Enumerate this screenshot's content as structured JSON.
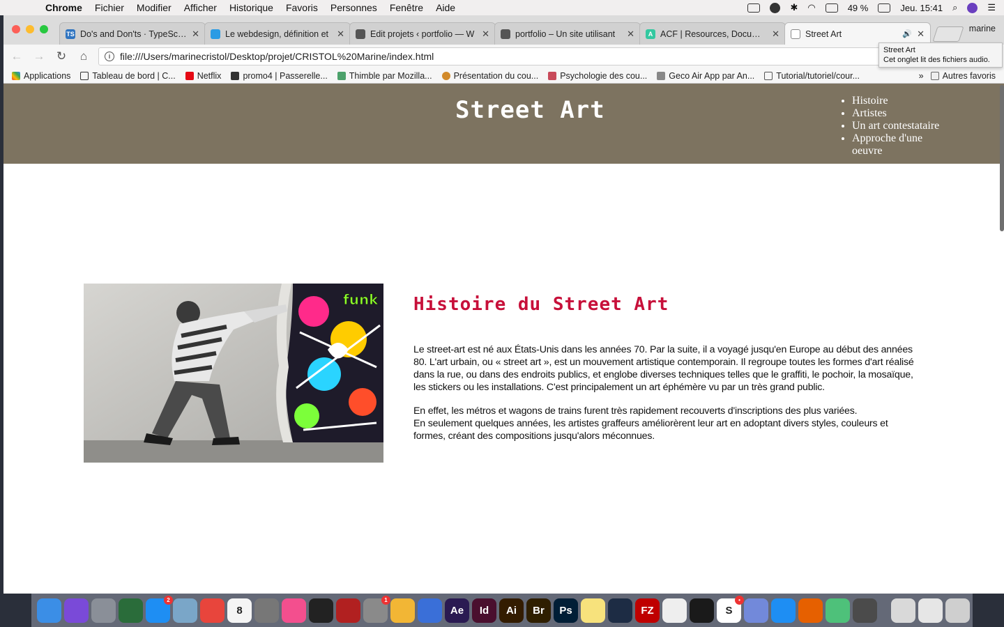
{
  "menubar": {
    "app_name": "Chrome",
    "menus": [
      "Fichier",
      "Modifier",
      "Afficher",
      "Historique",
      "Favoris",
      "Personnes",
      "Fenêtre",
      "Aide"
    ],
    "battery": "49 %",
    "clock": "Jeu. 15:41"
  },
  "tabs": [
    {
      "title": "Do's and Don'ts · TypeScript",
      "favicon": "TS",
      "color": "#2f74c0"
    },
    {
      "title": "Le webdesign, définition et",
      "favicon": "",
      "color": "#2b9be4"
    },
    {
      "title": "Edit projets ‹ portfolio — W",
      "favicon": "",
      "color": "#555555"
    },
    {
      "title": "portfolio – Un site utilisant",
      "favicon": "",
      "color": "#555555"
    },
    {
      "title": "ACF | Resources, Documen",
      "favicon": "A",
      "color": "#33c8a0"
    },
    {
      "title": "Street Art",
      "favicon": "",
      "color": "#ffffff"
    }
  ],
  "profile_name": "marine",
  "address_url": "file:///Users/marinecristol/Desktop/projet/CRISTOL%20Marine/index.html",
  "tooltip": {
    "title": "Street Art",
    "text": "Cet onglet lit des fichiers audio."
  },
  "bookmarks": [
    "Applications",
    "Tableau de bord | C...",
    "Netflix",
    "promo4 | Passerelle...",
    "Thimble par Mozilla...",
    "Présentation du cou...",
    "Psychologie des cou...",
    "Geco Air App par An...",
    "Tutorial/tutoriel/cour..."
  ],
  "bookmarks_other": "Autres favoris",
  "site": {
    "title": "Street Art",
    "nav": [
      "Histoire",
      "Artistes",
      "Un art contestataire",
      "Approche d'une oeuvre"
    ],
    "article_title": "Histoire du Street Art",
    "paragraphs": [
      "Le street-art est né aux États-Unis dans les années 70. Par la suite, il a voyagé jusqu'en Europe au début des années 80. L'art urbain, ou « street art », est un mouvement artistique contemporain. Il regroupe toutes les formes d'art réalisé dans la rue, ou dans des endroits publics, et englobe diverses techniques telles que le graffiti, le pochoir, la mosaïque, les stickers ou les installations. C'est principalement un art éphémère vu par un très grand public.",
      "En effet, les métros et wagons de trains furent très rapidement recouverts d'inscriptions des plus variées.",
      "En seulement quelques années, les artistes graffeurs améliorèrent leur art en adoptant divers styles, couleurs et formes, créant des compositions jusqu'alors méconnues."
    ],
    "image_tag": "funk"
  },
  "dock": [
    {
      "name": "finder-icon",
      "color": "#3b8ee6",
      "label": ""
    },
    {
      "name": "siri-icon",
      "color": "#7a4ad8",
      "label": ""
    },
    {
      "name": "launchpad-icon",
      "color": "#8a8f98",
      "label": ""
    },
    {
      "name": "mission-control-icon",
      "color": "#2a6c3a",
      "label": ""
    },
    {
      "name": "app-store-icon",
      "color": "#1e8ef3",
      "label": "",
      "badge": "2"
    },
    {
      "name": "preview-icon",
      "color": "#7aa6c8",
      "label": ""
    },
    {
      "name": "chrome-icon",
      "color": "#e8453c",
      "label": ""
    },
    {
      "name": "calendar-icon",
      "color": "#f5f5f5",
      "label": "8"
    },
    {
      "name": "sequel-icon",
      "color": "#777777",
      "label": ""
    },
    {
      "name": "itunes-icon",
      "color": "#f34f8e",
      "label": ""
    },
    {
      "name": "activity-monitor-icon",
      "color": "#222222",
      "label": ""
    },
    {
      "name": "photo-booth-icon",
      "color": "#b12020",
      "label": ""
    },
    {
      "name": "system-preferences-icon",
      "color": "#8a8a8a",
      "label": "",
      "badge": "1"
    },
    {
      "name": "photos-icon",
      "color": "#f2b635",
      "label": ""
    },
    {
      "name": "keynote-icon",
      "color": "#3a6fd8",
      "label": ""
    },
    {
      "name": "after-effects-icon",
      "color": "#2a1a52",
      "label": "Ae"
    },
    {
      "name": "indesign-icon",
      "color": "#4a0f2e",
      "label": "Id"
    },
    {
      "name": "illustrator-icon",
      "color": "#331c00",
      "label": "Ai"
    },
    {
      "name": "bridge-icon",
      "color": "#2f1f00",
      "label": "Br"
    },
    {
      "name": "photoshop-icon",
      "color": "#001e36",
      "label": "Ps"
    },
    {
      "name": "notes-icon",
      "color": "#f7e27c",
      "label": ""
    },
    {
      "name": "cinema4d-icon",
      "color": "#1d2c44",
      "label": ""
    },
    {
      "name": "filezilla-icon",
      "color": "#bf0000",
      "label": "FZ"
    },
    {
      "name": "text-edit-icon",
      "color": "#eeeeee",
      "label": ""
    },
    {
      "name": "terminal-icon",
      "color": "#1a1a1a",
      "label": ""
    },
    {
      "name": "slack-icon",
      "color": "#ffffff",
      "label": "S",
      "badge": "•"
    },
    {
      "name": "discord-icon",
      "color": "#7289da",
      "label": ""
    },
    {
      "name": "messenger-icon",
      "color": "#1e8ef3",
      "label": ""
    },
    {
      "name": "firefox-icon",
      "color": "#e66000",
      "label": ""
    },
    {
      "name": "atom-icon",
      "color": "#4ec17a",
      "label": ""
    },
    {
      "name": "sublime-icon",
      "color": "#4b4b4b",
      "label": ""
    },
    {
      "name": "downloads-icon",
      "color": "#d9d9d9",
      "label": ""
    },
    {
      "name": "documents-icon",
      "color": "#e6e6e6",
      "label": ""
    },
    {
      "name": "trash-icon",
      "color": "#cfcfcf",
      "label": ""
    }
  ]
}
